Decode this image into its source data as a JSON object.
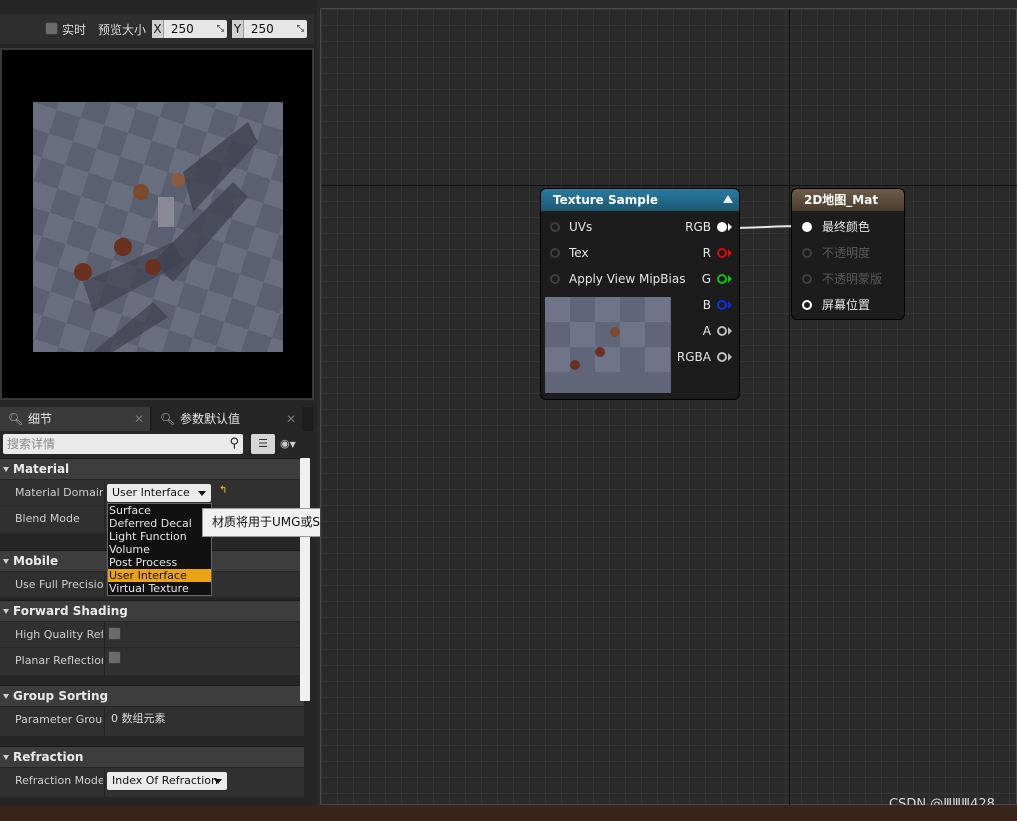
{
  "preview": {
    "realtime_label": "实时",
    "preview_size_label": "预览大小",
    "x_axis": "X",
    "x_value": "250",
    "y_axis": "Y",
    "y_value": "250"
  },
  "tabs": [
    {
      "label": "细节"
    },
    {
      "label": "参数默认值"
    }
  ],
  "search": {
    "placeholder": "搜索详情"
  },
  "sections": {
    "material": "Material",
    "mobile": "Mobile",
    "forward_shading": "Forward Shading",
    "group_sorting": "Group Sorting",
    "refraction": "Refraction"
  },
  "properties": {
    "material_domain": {
      "label": "Material Domain",
      "value": "User Interface"
    },
    "blend_mode": {
      "label": "Blend Mode"
    },
    "use_full_precision": {
      "label": "Use Full Precision"
    },
    "high_quality_reflections": {
      "label": "High Quality Reflections"
    },
    "planar_reflections": {
      "label": "Planar Reflections"
    },
    "parameter_group": {
      "label": "Parameter Group",
      "value": "0 数组元素"
    },
    "refraction_mode": {
      "label": "Refraction Mode",
      "value": "Index Of Refraction"
    }
  },
  "domain_options": [
    "Surface",
    "Deferred Decal",
    "Light Function",
    "Volume",
    "Post Process",
    "User Interface",
    "Virtual Texture"
  ],
  "domain_selected": "User Interface",
  "tooltip": "材质将用于UMG或Slate UI",
  "texture_node": {
    "title": "Texture Sample",
    "inputs": [
      "UVs",
      "Tex",
      "Apply View MipBias"
    ],
    "outputs": [
      "RGB",
      "R",
      "G",
      "B",
      "A",
      "RGBA"
    ],
    "color": "#1f5f7f"
  },
  "material_node": {
    "title": "2D地图_Mat",
    "inputs": [
      "最终颜色",
      "不透明度",
      "不透明蒙版",
      "屏幕位置"
    ],
    "color": "#5a4a3a"
  },
  "watermark": "CSDN @ⅢⅢⅢ428",
  "colors": {
    "highlight": "#e8a317",
    "pin_r": "#d01010",
    "pin_g": "#10c010",
    "pin_b": "#1030e0"
  }
}
